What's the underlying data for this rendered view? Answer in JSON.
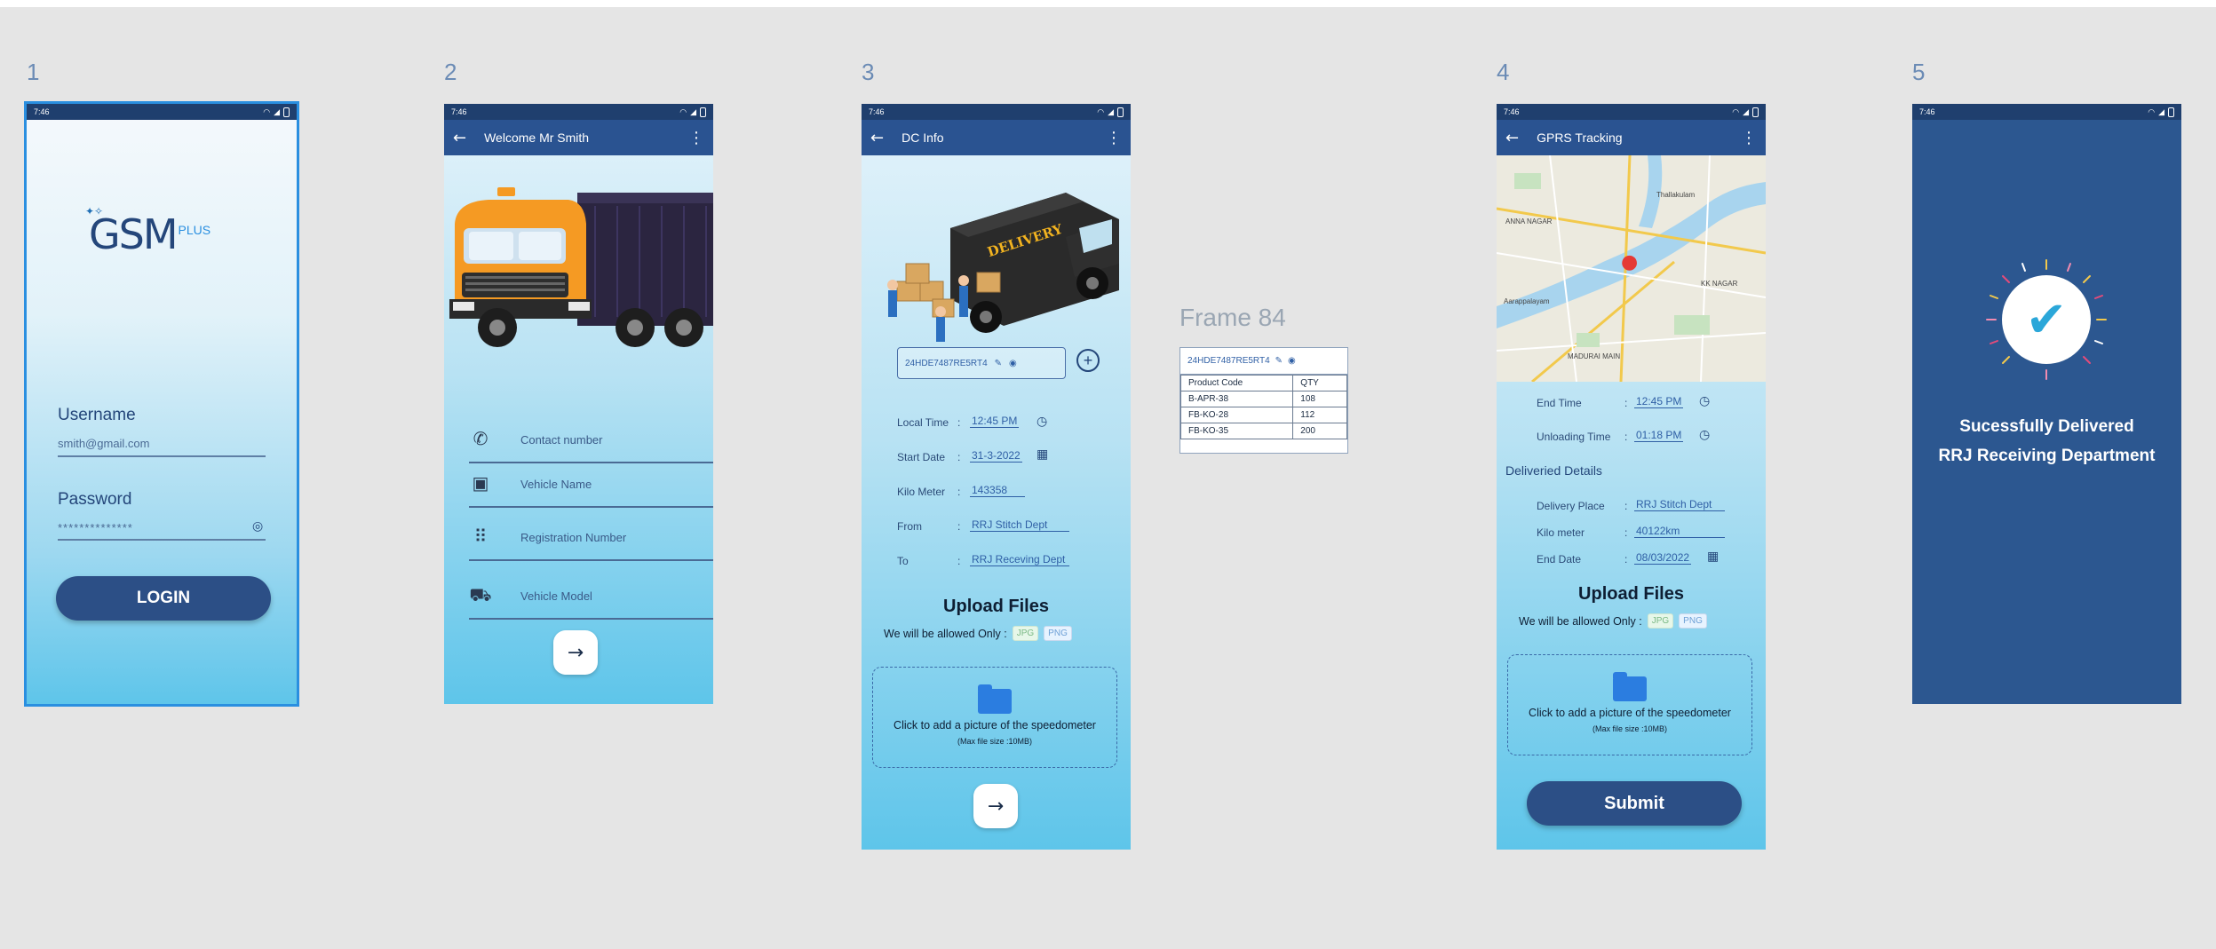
{
  "frames": {
    "f1": {
      "label": "1"
    },
    "f2": {
      "label": "2"
    },
    "f3": {
      "label": "3"
    },
    "f4": {
      "label": "4"
    },
    "f5": {
      "label": "5"
    },
    "frame84": {
      "label": "Frame 84"
    }
  },
  "status": {
    "time": "7:46"
  },
  "login": {
    "logo_main": "GSM",
    "logo_sup": "PLUS",
    "username_label": "Username",
    "username_value": "smith@gmail.com",
    "password_label": "Password",
    "password_value": "**************",
    "login_button": "LOGIN"
  },
  "welcome": {
    "title": "Welcome Mr Smith",
    "fields": [
      {
        "placeholder": "Contact number",
        "icon": "phone-icon"
      },
      {
        "placeholder": "Vehicle Name",
        "icon": "bus-icon"
      },
      {
        "placeholder": "Registration Number",
        "icon": "dialpad-icon"
      },
      {
        "placeholder": "Vehicle Model",
        "icon": "truck-icon"
      }
    ]
  },
  "dcinfo": {
    "title": "DC Info",
    "dc_code": "24HDE7487RE5RT4",
    "local_time_label": "Local Time",
    "local_time": "12:45 PM",
    "start_date_label": "Start Date",
    "start_date": "31-3-2022",
    "kilometer_label": "Kilo Meter",
    "kilometer": "143358",
    "from_label": "From",
    "from": "RRJ Stitch Dept",
    "to_label": "To",
    "to": "RRJ Receving Dept",
    "upload_title": "Upload Files",
    "allowed_text": "We will be allowed Only :",
    "chip_jpg": "JPG",
    "chip_png": "PNG",
    "drop_text": "Click to add a picture of the speedometer",
    "drop_sub": "(Max file size :10MB)",
    "delivery_text": "DELIVERY"
  },
  "frame84": {
    "code": "24HDE7487RE5RT4",
    "headers": [
      "Product Code",
      "QTY"
    ],
    "rows": [
      [
        "B-APR-38",
        "108"
      ],
      [
        "FB-KO-28",
        "112"
      ],
      [
        "FB-KO-35",
        "200"
      ]
    ]
  },
  "gprs": {
    "title": "GPRS Tracking",
    "end_time_label": "End Time",
    "end_time": "12:45 PM",
    "unloading_label": "Unloading Time",
    "unloading_time": "01:18 PM",
    "delivered_heading": "Deliveried Details",
    "delivery_place_label": "Delivery Place",
    "delivery_place": "RRJ Stitch Dept",
    "kilometer_label": "Kilo meter",
    "kilometer": "40122km",
    "end_date_label": "End Date",
    "end_date": "08/03/2022",
    "upload_title": "Upload Files",
    "allowed_text": "We will be allowed Only :",
    "chip_jpg": "JPG",
    "chip_png": "PNG",
    "drop_text": "Click to add a picture of the speedometer",
    "drop_sub": "(Max file size :10MB)",
    "submit": "Submit",
    "map_labels": [
      "MADURAI MAIN",
      "ANNA NAGAR",
      "KK NAGAR",
      "Thallakulam",
      "Aarappalayam"
    ]
  },
  "success": {
    "line1": "Sucessfully Delivered",
    "line2": "RRJ Receiving Department"
  },
  "colors": {
    "primary": "#2a5391",
    "gradient_end": "#5ec5ea",
    "success_bg": "#2c5790"
  }
}
